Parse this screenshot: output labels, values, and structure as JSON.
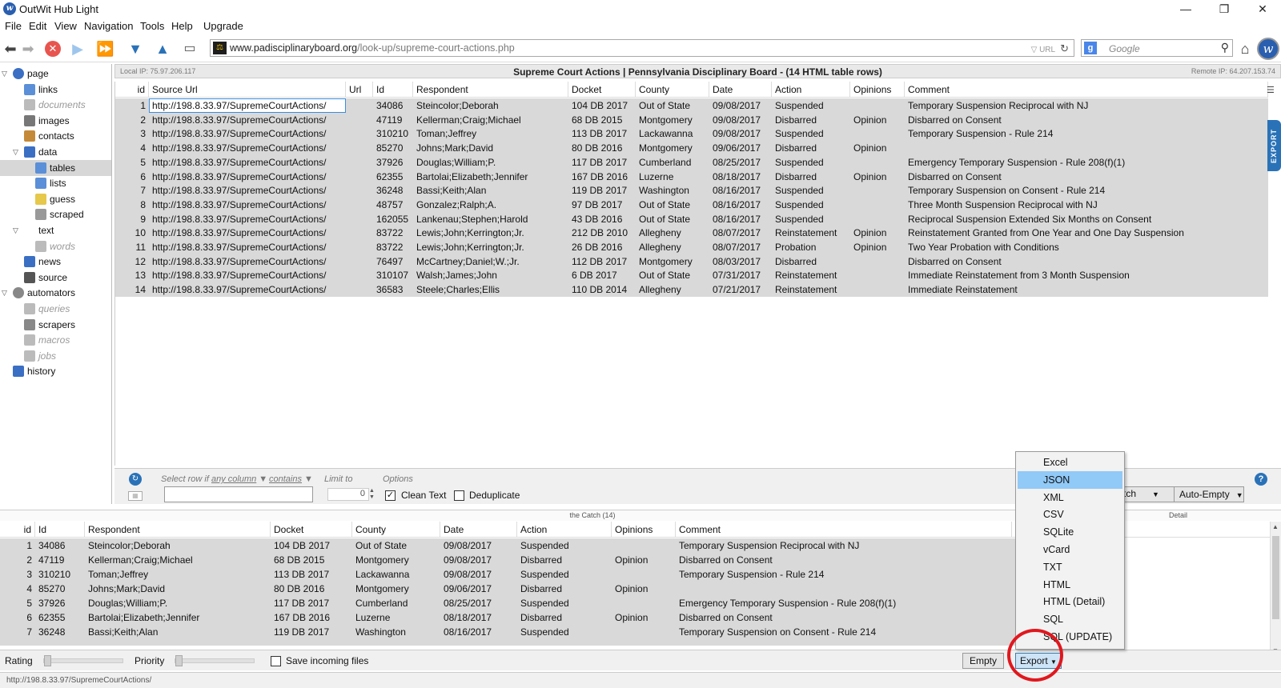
{
  "window": {
    "title": "OutWit Hub Light",
    "minimize": "—",
    "maximize": "❐",
    "close": "✕"
  },
  "menu": [
    "File",
    "Edit",
    "View",
    "Navigation",
    "Tools",
    "Help",
    "Upgrade"
  ],
  "toolbar": {
    "url_domain": "www.padisciplinaryboard.org",
    "url_path": "/look-up/supreme-court-actions.php",
    "url_tail": "URL",
    "search_placeholder": "Google"
  },
  "sidebar": [
    {
      "label": "page",
      "depth": 0,
      "twisty": "down",
      "icon": "globe-icon",
      "color": "#3b6fc4"
    },
    {
      "label": "links",
      "depth": 1,
      "icon": "links-icon",
      "color": "#5b8fd8"
    },
    {
      "label": "documents",
      "depth": 1,
      "icon": "document-icon",
      "color": "#bbbbbb",
      "disabled": true
    },
    {
      "label": "images",
      "depth": 1,
      "icon": "image-icon",
      "color": "#777777"
    },
    {
      "label": "contacts",
      "depth": 1,
      "icon": "contacts-icon",
      "color": "#c48a3a"
    },
    {
      "label": "data",
      "depth": 1,
      "twisty": "down",
      "icon": "data-icon",
      "color": "#3b6fc4"
    },
    {
      "label": "tables",
      "depth": 2,
      "icon": "table-icon",
      "color": "#5b8fd8",
      "selected": true
    },
    {
      "label": "lists",
      "depth": 2,
      "icon": "list-icon",
      "color": "#5b8fd8"
    },
    {
      "label": "guess",
      "depth": 2,
      "icon": "guess-icon",
      "color": "#e6c84a"
    },
    {
      "label": "scraped",
      "depth": 2,
      "icon": "scraped-icon",
      "color": "#999999"
    },
    {
      "label": "text",
      "depth": 1,
      "twisty": "down",
      "icon": "",
      "color": ""
    },
    {
      "label": "words",
      "depth": 2,
      "icon": "words-icon",
      "color": "#bbbbbb",
      "disabled": true
    },
    {
      "label": "news",
      "depth": 1,
      "icon": "news-icon",
      "color": "#3b6fc4"
    },
    {
      "label": "source",
      "depth": 1,
      "icon": "source-icon",
      "color": "#555555"
    },
    {
      "label": "automators",
      "depth": 0,
      "twisty": "down",
      "icon": "automators-icon",
      "color": "#888888"
    },
    {
      "label": "queries",
      "depth": 1,
      "icon": "queries-icon",
      "color": "#bbbbbb",
      "disabled": true
    },
    {
      "label": "scrapers",
      "depth": 1,
      "icon": "scrapers-icon",
      "color": "#888888"
    },
    {
      "label": "macros",
      "depth": 1,
      "icon": "macros-icon",
      "color": "#bbbbbb",
      "disabled": true
    },
    {
      "label": "jobs",
      "depth": 1,
      "icon": "jobs-icon",
      "color": "#bbbbbb",
      "disabled": true
    },
    {
      "label": "history",
      "depth": 0,
      "icon": "history-icon",
      "color": "#3b6fc4"
    }
  ],
  "info": {
    "local_ip": "Local IP:   75.97.206.117",
    "caption": "Supreme Court Actions | Pennsylvania Disciplinary Board - (14 HTML table rows)",
    "remote_ip": "Remote IP:   64.207.153.74"
  },
  "grid": {
    "columns": [
      "id",
      "Source Url",
      "Url",
      "Id",
      "Respondent",
      "Docket",
      "County",
      "Date",
      "Action",
      "Opinions",
      "Comment"
    ],
    "rows": [
      [
        "1",
        "http://198.8.33.97/SupremeCourtActions/",
        "",
        "34086",
        "Steincolor;Deborah",
        "104 DB 2017",
        "Out of State",
        "09/08/2017",
        "Suspended",
        "",
        "Temporary Suspension Reciprocal with NJ"
      ],
      [
        "2",
        "http://198.8.33.97/SupremeCourtActions/",
        "",
        "47119",
        "Kellerman;Craig;Michael",
        "68 DB 2015",
        "Montgomery",
        "09/08/2017",
        "Disbarred",
        "Opinion",
        "Disbarred on Consent"
      ],
      [
        "3",
        "http://198.8.33.97/SupremeCourtActions/",
        "",
        "310210",
        "Toman;Jeffrey",
        "113 DB 2017",
        "Lackawanna",
        "09/08/2017",
        "Suspended",
        "",
        "Temporary Suspension - Rule 214"
      ],
      [
        "4",
        "http://198.8.33.97/SupremeCourtActions/",
        "",
        "85270",
        "Johns;Mark;David",
        "80 DB 2016",
        "Montgomery",
        "09/06/2017",
        "Disbarred",
        "Opinion",
        ""
      ],
      [
        "5",
        "http://198.8.33.97/SupremeCourtActions/",
        "",
        "37926",
        "Douglas;William;P.",
        "117 DB 2017",
        "Cumberland",
        "08/25/2017",
        "Suspended",
        "",
        "Emergency Temporary Suspension - Rule 208(f)(1)"
      ],
      [
        "6",
        "http://198.8.33.97/SupremeCourtActions/",
        "",
        "62355",
        "Bartolai;Elizabeth;Jennifer",
        "167 DB 2016",
        "Luzerne",
        "08/18/2017",
        "Disbarred",
        "Opinion",
        "Disbarred on Consent"
      ],
      [
        "7",
        "http://198.8.33.97/SupremeCourtActions/",
        "",
        "36248",
        "Bassi;Keith;Alan",
        "119 DB 2017",
        "Washington",
        "08/16/2017",
        "Suspended",
        "",
        "Temporary Suspension on Consent - Rule 214"
      ],
      [
        "8",
        "http://198.8.33.97/SupremeCourtActions/",
        "",
        "48757",
        "Gonzalez;Ralph;A.",
        "97 DB 2017",
        "Out of State",
        "08/16/2017",
        "Suspended",
        "",
        "Three Month Suspension Reciprocal with NJ"
      ],
      [
        "9",
        "http://198.8.33.97/SupremeCourtActions/",
        "",
        "162055",
        "Lankenau;Stephen;Harold",
        "43 DB 2016",
        "Out of State",
        "08/16/2017",
        "Suspended",
        "",
        "Reciprocal Suspension Extended Six Months on Consent"
      ],
      [
        "10",
        "http://198.8.33.97/SupremeCourtActions/",
        "",
        "83722",
        "Lewis;John;Kerrington;Jr.",
        "212 DB 2010",
        "Allegheny",
        "08/07/2017",
        "Reinstatement",
        "Opinion",
        "Reinstatement Granted from One Year and One Day Suspension"
      ],
      [
        "11",
        "http://198.8.33.97/SupremeCourtActions/",
        "",
        "83722",
        "Lewis;John;Kerrington;Jr.",
        "26 DB 2016",
        "Allegheny",
        "08/07/2017",
        "Probation",
        "Opinion",
        "Two Year Probation with Conditions"
      ],
      [
        "12",
        "http://198.8.33.97/SupremeCourtActions/",
        "",
        "76497",
        "McCartney;Daniel;W.;Jr.",
        "112 DB 2017",
        "Montgomery",
        "08/03/2017",
        "Disbarred",
        "",
        "Disbarred on Consent"
      ],
      [
        "13",
        "http://198.8.33.97/SupremeCourtActions/",
        "",
        "310107",
        "Walsh;James;John",
        "6 DB 2017",
        "Out of State",
        "07/31/2017",
        "Reinstatement",
        "",
        "Immediate Reinstatement from 3 Month Suspension"
      ],
      [
        "14",
        "http://198.8.33.97/SupremeCourtActions/",
        "",
        "36583",
        "Steele;Charles;Ellis",
        "110 DB 2014",
        "Allegheny",
        "07/21/2017",
        "Reinstatement",
        "",
        "Immediate Reinstatement"
      ]
    ]
  },
  "filter": {
    "select_row_label": "Select row if",
    "any_column": "any column",
    "contains": "contains",
    "limit_label": "Limit to",
    "limit_value": "0",
    "options_label": "Options",
    "clean_text": "Clean Text",
    "clean_text_checked": true,
    "deduplicate": "Deduplicate",
    "deduplicate_checked": false,
    "catch_btn": "tch",
    "auto_empty": "Auto-Empty"
  },
  "catch": {
    "label": "the Catch   (14)",
    "detail": "Detail",
    "columns": [
      "id",
      "Id",
      "Respondent",
      "Docket",
      "County",
      "Date",
      "Action",
      "Opinions",
      "Comment"
    ],
    "rows": [
      [
        "1",
        "34086",
        "Steincolor;Deborah",
        "104 DB 2017",
        "Out of State",
        "09/08/2017",
        "Suspended",
        "",
        "Temporary Suspension Reciprocal with NJ"
      ],
      [
        "2",
        "47119",
        "Kellerman;Craig;Michael",
        "68 DB 2015",
        "Montgomery",
        "09/08/2017",
        "Disbarred",
        "Opinion",
        "Disbarred on Consent"
      ],
      [
        "3",
        "310210",
        "Toman;Jeffrey",
        "113 DB 2017",
        "Lackawanna",
        "09/08/2017",
        "Suspended",
        "",
        "Temporary Suspension - Rule 214"
      ],
      [
        "4",
        "85270",
        "Johns;Mark;David",
        "80 DB 2016",
        "Montgomery",
        "09/06/2017",
        "Disbarred",
        "Opinion",
        ""
      ],
      [
        "5",
        "37926",
        "Douglas;William;P.",
        "117 DB 2017",
        "Cumberland",
        "08/25/2017",
        "Suspended",
        "",
        "Emergency Temporary Suspension - Rule 208(f)(1)"
      ],
      [
        "6",
        "62355",
        "Bartolai;Elizabeth;Jennifer",
        "167 DB 2016",
        "Luzerne",
        "08/18/2017",
        "Disbarred",
        "Opinion",
        "Disbarred on Consent"
      ],
      [
        "7",
        "36248",
        "Bassi;Keith;Alan",
        "119 DB 2017",
        "Washington",
        "08/16/2017",
        "Suspended",
        "",
        "Temporary Suspension on Consent - Rule 214"
      ]
    ]
  },
  "bottom": {
    "rating": "Rating",
    "priority": "Priority",
    "save_incoming": "Save incoming files",
    "empty": "Empty",
    "export": "Export"
  },
  "export_menu": {
    "items": [
      "Excel",
      "JSON",
      "XML",
      "CSV",
      "SQLite",
      "vCard",
      "TXT",
      "HTML",
      "HTML (Detail)",
      "SQL",
      "SQL (UPDATE)"
    ],
    "highlighted": "JSON"
  },
  "status": "http://198.8.33.97/SupremeCourtActions/",
  "export_tab": "EXPORT",
  "colors": {
    "accent": "#2a72b8",
    "row_bg": "#d9d9d9",
    "highlight": "#91c9f7",
    "annotation": "#e0181e"
  }
}
